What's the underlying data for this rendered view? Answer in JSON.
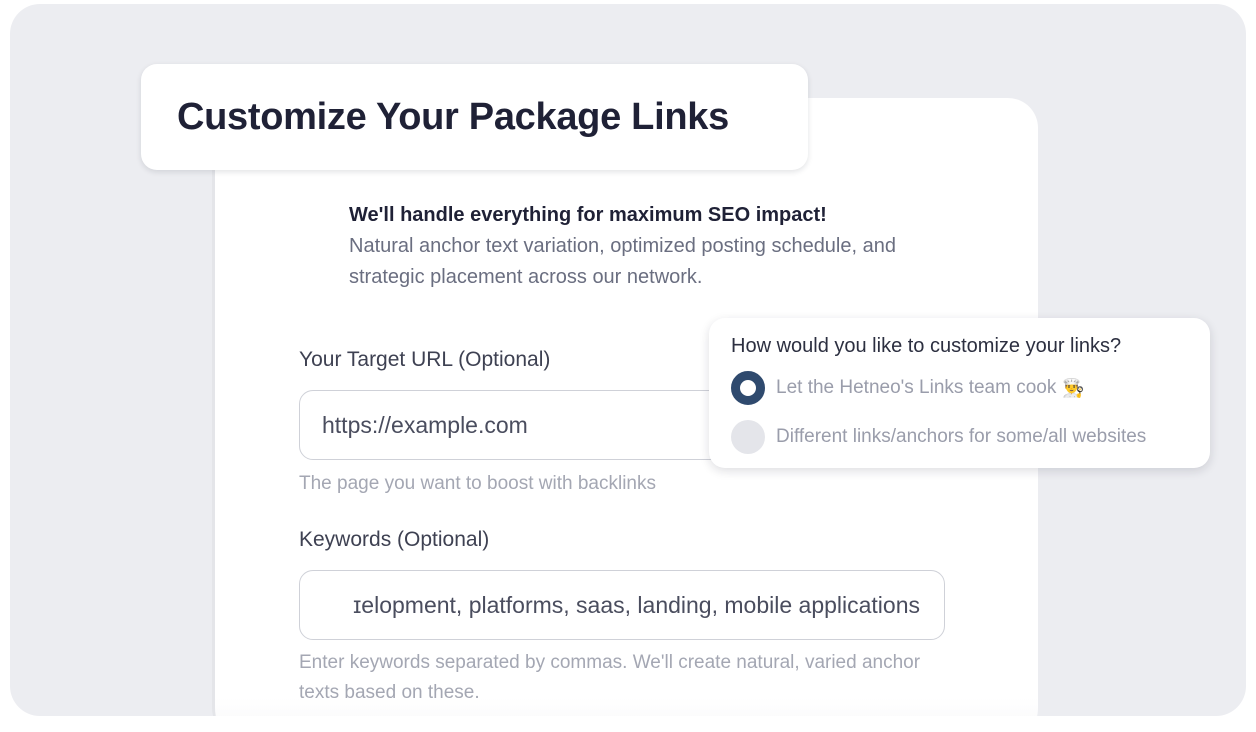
{
  "title": "Customize Your Package Links",
  "notice": {
    "heading": "We'll handle everything for maximum SEO impact!",
    "body": "Natural anchor text variation, optimized posting schedule, and strategic placement across our network."
  },
  "target_url": {
    "label": "Your Target URL (Optional)",
    "value": "https://example.com",
    "hint": "The page you want to boost with backlinks"
  },
  "keywords": {
    "label": "Keywords (Optional)",
    "value": "ɪelopment, platforms, saas, landing, mobile applications",
    "hint": "Enter keywords separated by commas. We'll create natural, varied anchor texts based on these."
  },
  "customize_popover": {
    "question": "How would you like to customize your links?",
    "options": [
      {
        "label": "Let the Hetneo's Links team cook",
        "icon": "chef-emoji",
        "selected": true
      },
      {
        "label": "Different links/anchors for some/all websites",
        "selected": false
      }
    ]
  },
  "colors": {
    "background": "#ecedf1",
    "title_text": "#1f2136",
    "radio_selected": "#2f4a6e",
    "hint_text": "#a4a7b3"
  }
}
